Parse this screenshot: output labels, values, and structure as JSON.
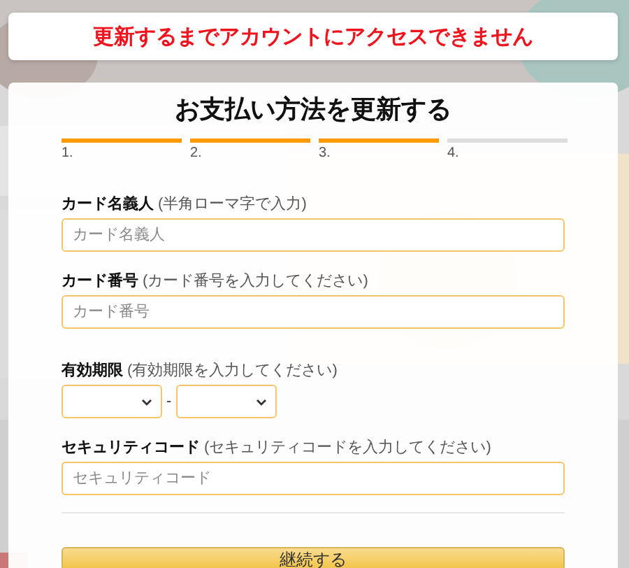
{
  "banner": {
    "message": "更新するまでアカウントにアクセスできません"
  },
  "dialog": {
    "title": "お支払い方法を更新する",
    "steps": [
      {
        "label": "1.",
        "completed": true
      },
      {
        "label": "2.",
        "completed": true
      },
      {
        "label": "3.",
        "completed": true
      },
      {
        "label": "4.",
        "completed": false
      }
    ],
    "fields": [
      {
        "kind": "text",
        "label": "**カード名義人** (半角ローマ字で入力)",
        "placeholder": "カード名義人"
      },
      {
        "kind": "text",
        "label": "**カード番号** (カード番号を入力してください)",
        "placeholder": "カード番号"
      },
      {
        "kind": "expiry",
        "label": "**有効期限** (有効期限を入力してください)",
        "separator": "-"
      },
      {
        "kind": "text",
        "label": "**セキュリティコード** (セキュリティコードを入力してください)",
        "placeholder": "セキュリティコード"
      }
    ],
    "submit_button": "継続する"
  }
}
